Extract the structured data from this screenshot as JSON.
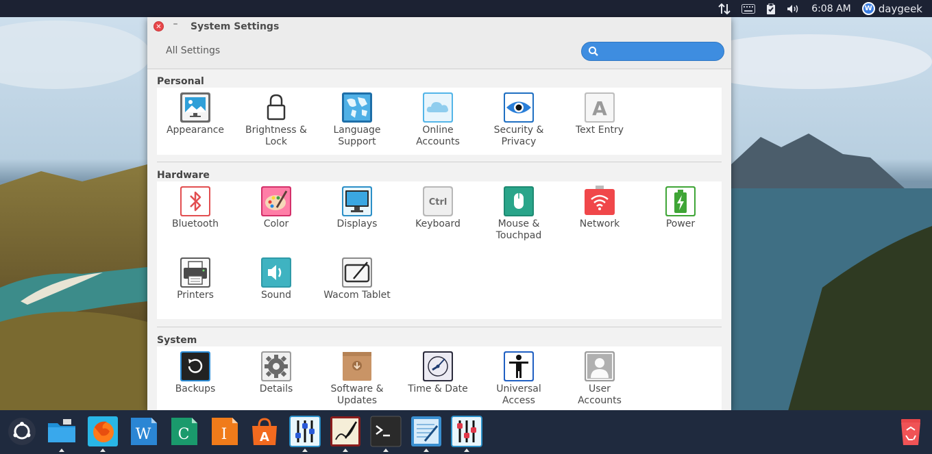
{
  "top_panel": {
    "time": "6:08 AM",
    "user": "daygeek",
    "icons": [
      "network-arrows-icon",
      "keyboard-icon",
      "clipboard-check-icon",
      "volume-icon",
      "user-badge-icon"
    ]
  },
  "window": {
    "title": "System Settings",
    "breadcrumb": "All Settings",
    "search_placeholder": "",
    "colors": {
      "search_bg": "#3e8de0",
      "close": "#e8474a",
      "dock_bg": "#1f2a3e",
      "panel_bg": "#1c2233"
    }
  },
  "sections": [
    {
      "title": "Personal",
      "items": [
        {
          "label": "Appearance",
          "icon": "appearance-icon"
        },
        {
          "label": "Brightness &\nLock",
          "icon": "lock-icon"
        },
        {
          "label": "Language\nSupport",
          "icon": "world-map-icon"
        },
        {
          "label": "Online\nAccounts",
          "icon": "cloud-icon"
        },
        {
          "label": "Security &\nPrivacy",
          "icon": "eye-icon"
        },
        {
          "label": "Text Entry",
          "icon": "text-a-icon"
        }
      ]
    },
    {
      "title": "Hardware",
      "items": [
        {
          "label": "Bluetooth",
          "icon": "bluetooth-icon"
        },
        {
          "label": "Color",
          "icon": "palette-icon"
        },
        {
          "label": "Displays",
          "icon": "monitor-icon"
        },
        {
          "label": "Keyboard",
          "icon": "ctrl-key-icon"
        },
        {
          "label": "Mouse &\nTouchpad",
          "icon": "mouse-icon"
        },
        {
          "label": "Network",
          "icon": "wifi-icon"
        },
        {
          "label": "Power",
          "icon": "battery-icon"
        },
        {
          "label": "Printers",
          "icon": "printer-icon"
        },
        {
          "label": "Sound",
          "icon": "speaker-icon"
        },
        {
          "label": "Wacom Tablet",
          "icon": "tablet-pen-icon"
        }
      ]
    },
    {
      "title": "System",
      "items": [
        {
          "label": "Backups",
          "icon": "backup-icon"
        },
        {
          "label": "Details",
          "icon": "gear-icon"
        },
        {
          "label": "Software &\nUpdates",
          "icon": "package-icon"
        },
        {
          "label": "Time & Date",
          "icon": "clock-icon"
        },
        {
          "label": "Universal\nAccess",
          "icon": "accessibility-icon"
        },
        {
          "label": "User\nAccounts",
          "icon": "user-icon"
        }
      ]
    }
  ],
  "dock": {
    "apps": [
      "ubuntu-logo-icon",
      "files-folder-icon",
      "firefox-icon",
      "writer-icon",
      "calc-icon",
      "impress-icon",
      "software-center-icon",
      "mixer-icon",
      "drawing-icon",
      "terminal-icon",
      "text-editor-icon",
      "settings-mixer-icon"
    ],
    "trash": "trash-icon"
  }
}
